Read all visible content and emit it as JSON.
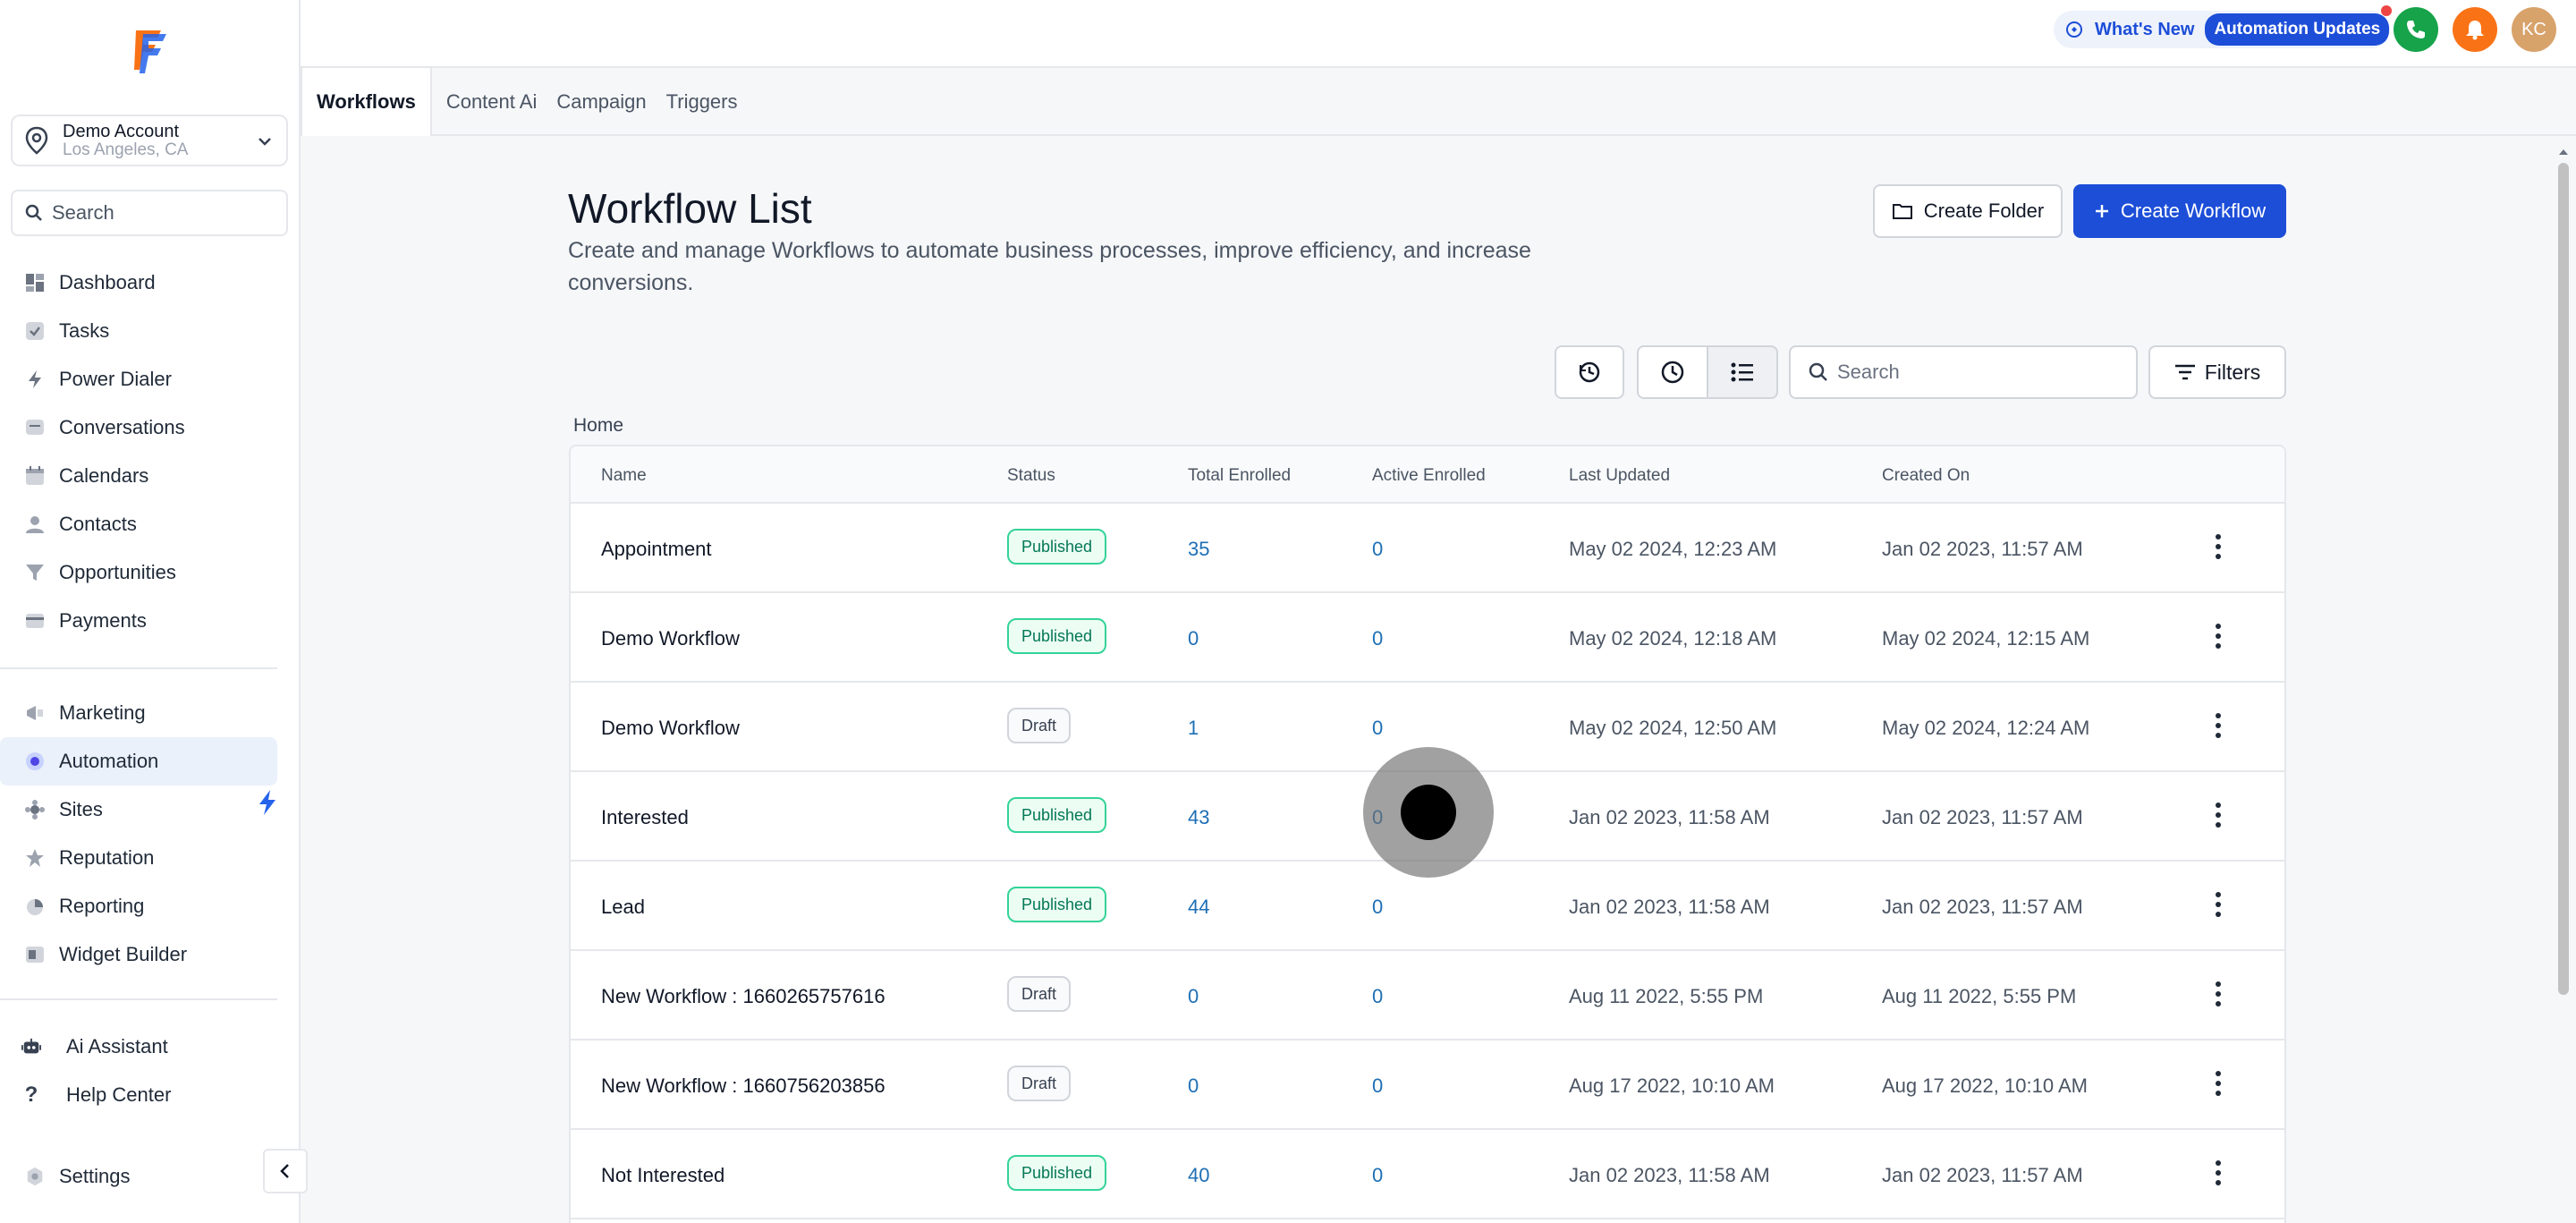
{
  "account": {
    "name": "Demo Account",
    "location": "Los Angeles, CA"
  },
  "sidebar": {
    "search_placeholder": "Search",
    "items": [
      {
        "label": "Dashboard",
        "icon": "dashboard-icon"
      },
      {
        "label": "Tasks",
        "icon": "tasks-icon"
      },
      {
        "label": "Power Dialer",
        "icon": "power-dialer-icon"
      },
      {
        "label": "Conversations",
        "icon": "conversations-icon"
      },
      {
        "label": "Calendars",
        "icon": "calendar-icon"
      },
      {
        "label": "Contacts",
        "icon": "contacts-icon"
      },
      {
        "label": "Opportunities",
        "icon": "opportunities-icon"
      },
      {
        "label": "Payments",
        "icon": "payments-icon"
      }
    ],
    "items2": [
      {
        "label": "Marketing",
        "icon": "marketing-icon"
      },
      {
        "label": "Automation",
        "icon": "automation-icon",
        "active": true
      },
      {
        "label": "Sites",
        "icon": "sites-icon"
      },
      {
        "label": "Reputation",
        "icon": "reputation-icon"
      },
      {
        "label": "Reporting",
        "icon": "reporting-icon"
      },
      {
        "label": "Widget Builder",
        "icon": "widget-builder-icon"
      }
    ],
    "items3": [
      {
        "label": "Ai Assistant",
        "icon": "robot-icon"
      },
      {
        "label": "Help Center",
        "icon": "question-icon"
      }
    ],
    "settings": "Settings"
  },
  "header": {
    "whats_new": "What's New",
    "automation_updates": "Automation Updates",
    "avatar_initials": "KC"
  },
  "tabs": [
    "Workflows",
    "Content Ai",
    "Campaign",
    "Triggers"
  ],
  "page": {
    "title": "Workflow List",
    "subtitle": "Create and manage Workflows to automate business processes, improve efficiency, and increase conversions.",
    "create_folder": "Create Folder",
    "create_workflow": "Create Workflow",
    "search_placeholder": "Search",
    "filters": "Filters",
    "breadcrumb": "Home"
  },
  "table": {
    "columns": [
      "Name",
      "Status",
      "Total Enrolled",
      "Active Enrolled",
      "Last Updated",
      "Created On"
    ],
    "rows": [
      [
        "Appointment",
        "Published",
        "35",
        "0",
        "May 02 2024, 12:23 AM",
        "Jan 02 2023, 11:57 AM"
      ],
      [
        "Demo Workflow",
        "Published",
        "0",
        "0",
        "May 02 2024, 12:18 AM",
        "May 02 2024, 12:15 AM"
      ],
      [
        "Demo Workflow",
        "Draft",
        "1",
        "0",
        "May 02 2024, 12:50 AM",
        "May 02 2024, 12:24 AM"
      ],
      [
        "Interested",
        "Published",
        "43",
        "0",
        "Jan 02 2023, 11:58 AM",
        "Jan 02 2023, 11:57 AM"
      ],
      [
        "Lead",
        "Published",
        "44",
        "0",
        "Jan 02 2023, 11:58 AM",
        "Jan 02 2023, 11:57 AM"
      ],
      [
        "New Workflow : 1660265757616",
        "Draft",
        "0",
        "0",
        "Aug 11 2022, 5:55 PM",
        "Aug 11 2022, 5:55 PM"
      ],
      [
        "New Workflow : 1660756203856",
        "Draft",
        "0",
        "0",
        "Aug 17 2022, 10:10 AM",
        "Aug 17 2022, 10:10 AM"
      ],
      [
        "Not Interested",
        "Published",
        "40",
        "0",
        "Jan 02 2023, 11:58 AM",
        "Jan 02 2023, 11:57 AM"
      ]
    ]
  },
  "colors": {
    "accent": "#1d4ed8",
    "published": "#047857",
    "link_number": "#1e6fb5"
  }
}
